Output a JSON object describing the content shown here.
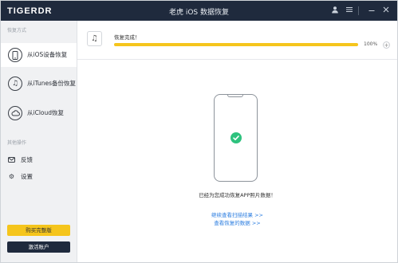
{
  "titlebar": {
    "logo": "TIGERDR",
    "title": "老虎 iOS 数据恢复",
    "icons": [
      "user-icon",
      "menu-icon",
      "minimize-icon",
      "close-icon"
    ]
  },
  "sidebar": {
    "section_recovery": "恢复方式",
    "items": [
      {
        "label": "从iOS设备恢复",
        "icon": "phone-icon",
        "active": true
      },
      {
        "label": "从iTunes备份恢复",
        "icon": "itunes-icon",
        "active": false
      },
      {
        "label": "从iCloud恢复",
        "icon": "cloud-icon",
        "active": false
      }
    ],
    "section_other": "其他操作",
    "other_items": [
      {
        "label": "反馈",
        "icon": "feedback-icon"
      },
      {
        "label": "设置",
        "icon": "gear-icon"
      }
    ],
    "buy_label": "购买完整版",
    "activate_label": "激活账户"
  },
  "progress": {
    "label": "恢复完成！",
    "percent_text": "100%",
    "value": 1.0,
    "plus": "+"
  },
  "main": {
    "success_message": "已经为您成功恢复APP照片数据！",
    "link_continue": "继续查看扫描结果 >>",
    "link_view": "查看恢复的数据 >>"
  },
  "colors": {
    "titlebar": "#1f2a3d",
    "accent_yellow": "#f5c51c",
    "success_green": "#2ec27e",
    "link_blue": "#2b7de0"
  }
}
